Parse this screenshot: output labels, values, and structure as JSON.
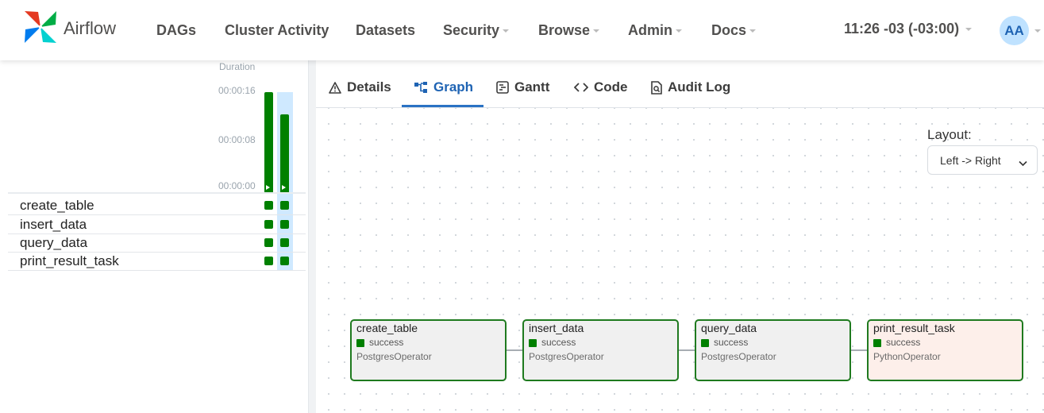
{
  "brand": {
    "name": "Airflow"
  },
  "nav": {
    "items": [
      {
        "label": "DAGs",
        "dropdown": false
      },
      {
        "label": "Cluster Activity",
        "dropdown": false
      },
      {
        "label": "Datasets",
        "dropdown": false
      },
      {
        "label": "Security",
        "dropdown": true
      },
      {
        "label": "Browse",
        "dropdown": true
      },
      {
        "label": "Admin",
        "dropdown": true
      },
      {
        "label": "Docs",
        "dropdown": true
      }
    ],
    "time": "11:26 -03 (-03:00)",
    "user_initials": "AA"
  },
  "grid": {
    "duration_label": "Duration",
    "ticks": [
      "00:00:16",
      "00:00:08",
      "00:00:00"
    ],
    "runs": [
      {
        "duration_seconds": 16,
        "state": "success"
      },
      {
        "duration_seconds": 12.5,
        "state": "success",
        "selected": true
      }
    ],
    "tasks": [
      {
        "name": "create_table"
      },
      {
        "name": "insert_data"
      },
      {
        "name": "query_data"
      },
      {
        "name": "print_result_task"
      }
    ]
  },
  "tabs": [
    {
      "label": "Details",
      "icon": "warning-triangle-icon"
    },
    {
      "label": "Graph",
      "icon": "graph-icon",
      "active": true
    },
    {
      "label": "Gantt",
      "icon": "gantt-icon"
    },
    {
      "label": "Code",
      "icon": "code-icon"
    },
    {
      "label": "Audit Log",
      "icon": "audit-log-icon"
    }
  ],
  "graph": {
    "layout_label": "Layout:",
    "layout_value": "Left -> Right",
    "nodes": [
      {
        "name": "create_table",
        "state": "success",
        "operator": "PostgresOperator"
      },
      {
        "name": "insert_data",
        "state": "success",
        "operator": "PostgresOperator"
      },
      {
        "name": "query_data",
        "state": "success",
        "operator": "PostgresOperator"
      },
      {
        "name": "print_result_task",
        "state": "success",
        "operator": "PythonOperator"
      }
    ]
  },
  "colors": {
    "success": "#008000",
    "accent": "#1e63b3",
    "selected_run": "#bfe2ff",
    "python_operator_bg": "#fdefea",
    "postgres_operator_bg": "#f0f0f0"
  }
}
